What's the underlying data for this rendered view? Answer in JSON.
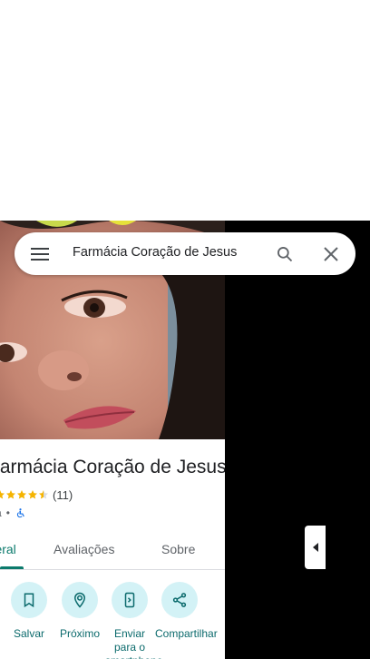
{
  "search": {
    "query": "Farmácia Coração de Jesus"
  },
  "place": {
    "title": "Farmácia Coração de Jesus",
    "rating_count": "(11)",
    "category_suffix": "a",
    "separator": "•",
    "stars": 4.5
  },
  "tabs": [
    {
      "label": "Visão geral"
    },
    {
      "label": "Avaliações"
    },
    {
      "label": "Sobre"
    }
  ],
  "actions": [
    {
      "label": "Salvar",
      "icon": "bookmark-icon"
    },
    {
      "label": "Próximo",
      "icon": "nearby-icon"
    },
    {
      "label": "Enviar para o smartphone",
      "icon": "send-to-phone-icon"
    },
    {
      "label": "Compartilhar",
      "icon": "share-icon"
    }
  ],
  "colors": {
    "accent": "#0b7a6c",
    "action_bg": "#d3f2f6",
    "star": "#f5b400"
  }
}
